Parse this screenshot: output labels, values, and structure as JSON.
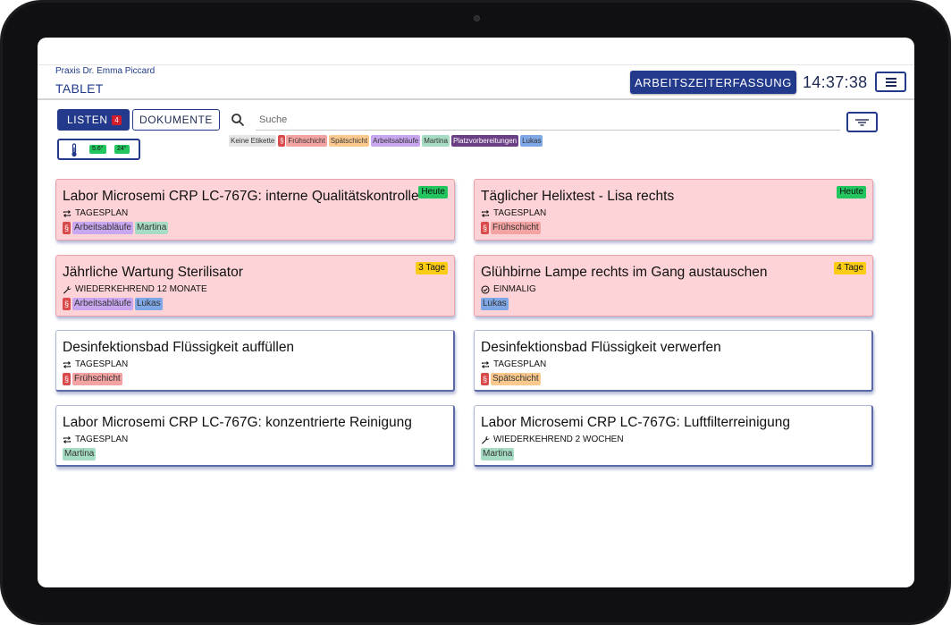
{
  "header": {
    "practice_name": "Praxis Dr. Emma Piccard",
    "app_title": "TABLET",
    "time_tracking_label": "ARBEITSZEITERFASSUNG",
    "clock": "14:37:38"
  },
  "toolbar": {
    "tabs": [
      {
        "label": "LISTEN",
        "badge": "4",
        "active": true
      },
      {
        "label": "DOKUMENTE",
        "active": false
      }
    ],
    "temperatures": [
      "5.6°",
      "24°"
    ],
    "search": {
      "placeholder": "Suche",
      "value": ""
    },
    "label_filters": [
      {
        "label": "Keine Etikette",
        "color": "#e5e5e5"
      },
      {
        "label": "Frühschicht",
        "color": "#f4a3a3",
        "section_icon": true
      },
      {
        "label": "Spätschicht",
        "color": "#fbc98e"
      },
      {
        "label": "Arbeitsabläufe",
        "color": "#c9a6f0"
      },
      {
        "label": "Martina",
        "color": "#a7dcc4"
      },
      {
        "label": "Platzvorbereitungen",
        "color": "#6b3f86",
        "text_color": "#ffffff"
      },
      {
        "label": "Lukas",
        "color": "#7ea7e6"
      }
    ]
  },
  "tasks": [
    {
      "title": "Labor Microsemi CRP LC-767G: interne Qualitätskontrolle",
      "type": "TAGESPLAN",
      "type_icon": "repeat-icon",
      "due": "Heute",
      "due_kind": "today",
      "overdue": true,
      "tags": [
        "§",
        "Arbeitsabläufe",
        "Martina"
      ]
    },
    {
      "title": "Täglicher Helixtest - Lisa rechts",
      "type": "TAGESPLAN",
      "type_icon": "repeat-icon",
      "due": "Heute",
      "due_kind": "today",
      "overdue": true,
      "tags": [
        "§",
        "Frühschicht"
      ]
    },
    {
      "title": "Jährliche Wartung Sterilisator",
      "type": "WIEDERKEHREND 12 MONATE",
      "type_icon": "wrench-icon",
      "due": "3 Tage",
      "due_kind": "days",
      "overdue": true,
      "tags": [
        "§",
        "Arbeitsabläufe",
        "Lukas"
      ]
    },
    {
      "title": "Glühbirne Lampe rechts im Gang austauschen",
      "type": "EINMALIG",
      "type_icon": "check-circle-icon",
      "due": "4 Tage",
      "due_kind": "days",
      "overdue": true,
      "tags": [
        "Lukas"
      ]
    },
    {
      "title": "Desinfektionsbad Flüssigkeit auffüllen",
      "type": "TAGESPLAN",
      "type_icon": "repeat-icon",
      "due": "",
      "overdue": false,
      "tags": [
        "§",
        "Frühschicht"
      ]
    },
    {
      "title": "Desinfektionsbad Flüssigkeit verwerfen",
      "type": "TAGESPLAN",
      "type_icon": "repeat-icon",
      "due": "",
      "overdue": false,
      "tags": [
        "§",
        "Spätschicht"
      ]
    },
    {
      "title": "Labor Microsemi CRP LC-767G: konzentrierte Reinigung",
      "type": "TAGESPLAN",
      "type_icon": "repeat-icon",
      "due": "",
      "overdue": false,
      "tags": [
        "Martina"
      ]
    },
    {
      "title": "Labor Microsemi CRP LC-767G: Luftfilterreinigung",
      "type": "WIEDERKEHREND 2 WOCHEN",
      "type_icon": "wrench-icon",
      "due": "",
      "overdue": false,
      "tags": [
        "Martina"
      ]
    }
  ],
  "tag_colors": {
    "Frühschicht": "#f4a3a3",
    "Spätschicht": "#fbc98e",
    "Arbeitsabläufe": "#c9a6f0",
    "Martina": "#a7dcc4",
    "Lukas": "#7ea7e6"
  }
}
